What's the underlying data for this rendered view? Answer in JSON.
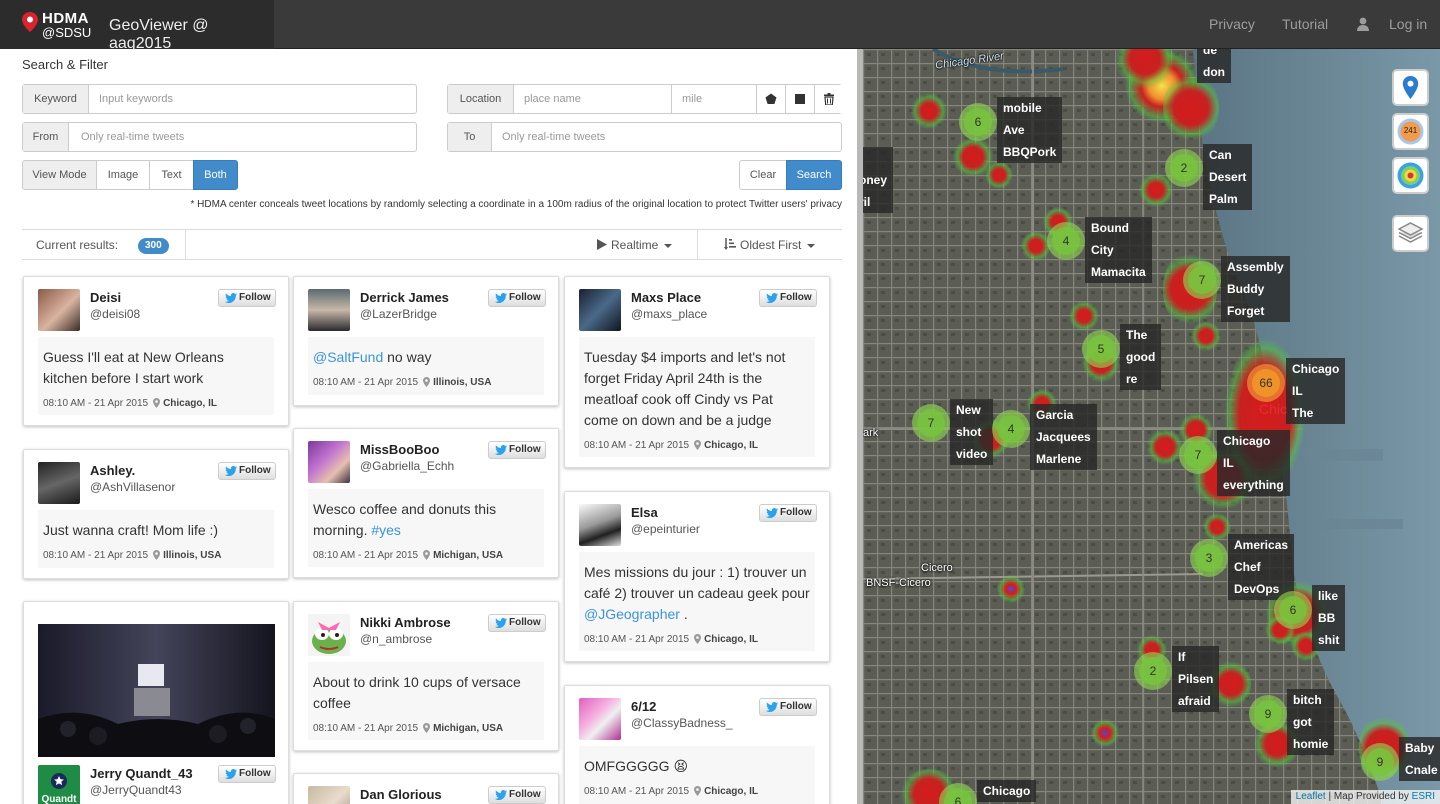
{
  "navbar": {
    "logo_line1": "HDMA",
    "logo_line2": "@SDSU",
    "app_title": "GeoViewer @ aag2015",
    "links": [
      "Privacy",
      "Tutorial"
    ],
    "login": "Log in"
  },
  "filter": {
    "title": "Search & Filter",
    "keyword_label": "Keyword",
    "keyword_placeholder": "Input keywords",
    "location_label": "Location",
    "place_placeholder": "place name",
    "mile_placeholder": "mile",
    "from_label": "From",
    "from_placeholder": "Only real-time tweets",
    "to_label": "To",
    "to_placeholder": "Only real-time tweets",
    "view_mode_label": "View Mode",
    "view_modes": [
      "Image",
      "Text",
      "Both"
    ],
    "active_view_mode": "Both",
    "clear_label": "Clear",
    "search_label": "Search",
    "note": "* HDMA center conceals tweet locations by randomly selecting a coordinate in a 100m radius of the original location to protect Twitter users' privacy"
  },
  "results": {
    "label": "Current results:",
    "count": "300",
    "mode": "Realtime",
    "order": "Oldest First"
  },
  "follow_label": "Follow",
  "tweets": [
    {
      "name": "Deisi",
      "handle": "@deisi08",
      "text": "Guess I'll eat at New Orleans kitchen before I start work",
      "time": "08:10 AM - 21 Apr 2015",
      "location": "Chicago, IL"
    },
    {
      "name": "Ashley.",
      "handle": "@AshVillasenor",
      "text": "Just wanna craft! Mom life :)",
      "time": "08:10 AM - 21 Apr 2015",
      "location": "Illinois, USA"
    },
    {
      "name": "Jerry Quandt_43",
      "handle": "@JerryQuandt43",
      "avatar_text": "Quandt"
    },
    {
      "name": "Derrick James",
      "handle": "@LazerBridge",
      "link": "@SaltFund",
      "text": " no way",
      "time": "08:10 AM - 21 Apr 2015",
      "location": "Illinois, USA"
    },
    {
      "name": "MissBooBoo",
      "handle": "@Gabriella_Echh",
      "text": "Wesco coffee and donuts this morning. ",
      "link": "#yes",
      "time": "08:10 AM - 21 Apr 2015",
      "location": "Michigan, USA"
    },
    {
      "name": "Nikki Ambrose",
      "handle": "@n_ambrose",
      "text": "About to drink 10 cups of versace coffee",
      "time": "08:10 AM - 21 Apr 2015",
      "location": "Michigan, USA"
    },
    {
      "name": "Dan Glorious",
      "handle": ""
    },
    {
      "name": "Maxs Place",
      "handle": "@maxs_place",
      "text": "Tuesday $4 imports and let's not forget Friday April 24th is the meatloaf cook off Cindy vs Pat come on down and be a judge",
      "time": "08:10 AM - 21 Apr 2015",
      "location": "Chicago, IL"
    },
    {
      "name": "Elsa",
      "handle": "@epeinturier",
      "text": "Mes missions du jour : 1) trouver un café 2) trouver un cadeau geek pour ",
      "link": "@JGeographer",
      "text_after": " .",
      "time": "08:10 AM - 21 Apr 2015",
      "location": "Chicago, IL"
    },
    {
      "name": "6/12",
      "handle": "@ClassyBadness_",
      "text": "OMFGGGGG 😫",
      "time": "08:10 AM - 21 Apr 2015",
      "location": "Chicago, IL"
    }
  ],
  "map": {
    "clusters": [
      {
        "count": "6",
        "words": [
          "mobile",
          "Ave",
          "BBQPork"
        ]
      },
      {
        "count": "2",
        "words": [
          "Can",
          "Desert",
          "Palm"
        ]
      },
      {
        "count": "4",
        "words": [
          "Bound",
          "City",
          "Mamacita"
        ]
      },
      {
        "count": "7",
        "words": [
          "Assembly",
          "Buddy",
          "Forget"
        ]
      },
      {
        "count": "5",
        "words": [
          "The",
          "good",
          "re"
        ]
      },
      {
        "count": "66",
        "words": [
          "Chicago",
          "IL",
          "The"
        ]
      },
      {
        "count": "7",
        "words": [
          "New",
          "shot",
          "video"
        ]
      },
      {
        "count": "4",
        "words": [
          "Garcia",
          "Jacquees",
          "Marlene"
        ]
      },
      {
        "count": "7",
        "words": [
          "Chicago",
          "IL",
          "everything"
        ]
      },
      {
        "count": "3",
        "words": [
          "Americas",
          "Chef",
          "DevOps"
        ]
      },
      {
        "count": "6",
        "words": [
          "like",
          "BB",
          "shit"
        ]
      },
      {
        "count": "2",
        "words": [
          "If",
          "Pilsen",
          "afraid"
        ]
      },
      {
        "count": "9",
        "words": [
          "bitch",
          "got",
          "homie"
        ]
      },
      {
        "count": "9",
        "words": [
          "Baby",
          "Cnale"
        ]
      },
      {
        "count": "6",
        "words": [
          "Chicago"
        ]
      }
    ],
    "partial_words_top": [
      "de",
      "don"
    ],
    "partial_words_left": [
      "oney",
      "ril"
    ],
    "places": [
      "Cicero",
      "BNSF-Cicero",
      "ark",
      "Chicago River",
      "Chic"
    ],
    "marker_count": "241",
    "attribution_leaflet": "Leaflet",
    "attribution_rest": " | Map Provided by ",
    "attribution_esri": "ESRI"
  }
}
